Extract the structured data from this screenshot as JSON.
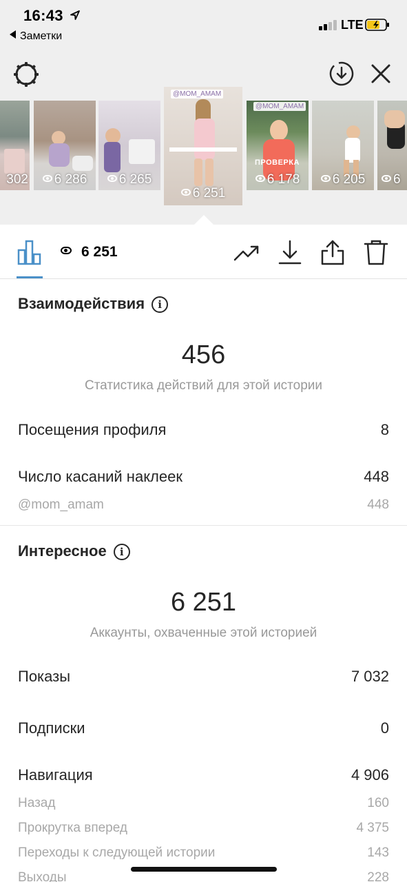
{
  "status_bar": {
    "time": "16:43",
    "back_app": "Заметки",
    "network": "LTE"
  },
  "colors": {
    "accent": "#4a90c8",
    "battery": "#f5c518",
    "header_bg": "#efefef"
  },
  "story_thumbnails": [
    {
      "views": "302",
      "selected": false
    },
    {
      "views": "6 286",
      "selected": false
    },
    {
      "views": "6 265",
      "selected": false
    },
    {
      "views": "6 251",
      "selected": true,
      "tag": "@MOM_AMAM"
    },
    {
      "views": "6 178",
      "selected": false,
      "tag": "@MOM_AMAM",
      "overlay": "ПРОВЕРКА"
    },
    {
      "views": "6 205",
      "selected": false
    },
    {
      "views": "6",
      "selected": false
    }
  ],
  "toolbar": {
    "views": "6 251",
    "icons": [
      "bar-chart-icon",
      "eye-icon",
      "trending-icon",
      "download-icon",
      "share-icon",
      "trash-icon"
    ]
  },
  "interactions": {
    "title": "Взаимодействия",
    "total": "456",
    "caption": "Статистика действий для этой истории",
    "rows": [
      {
        "label": "Посещения профиля",
        "value": "8"
      },
      {
        "label": "Число касаний наклеек",
        "value": "448"
      },
      {
        "label": "@mom_amam",
        "value": "448"
      }
    ]
  },
  "discovery": {
    "title": "Интересное",
    "total": "6 251",
    "caption": "Аккаунты, охваченные этой историей",
    "rows": [
      {
        "label": "Показы",
        "value": "7 032"
      },
      {
        "label": "Подписки",
        "value": "0"
      },
      {
        "label": "Навигация",
        "value": "4 906"
      },
      {
        "label": "Назад",
        "value": "160"
      },
      {
        "label": "Прокрутка вперед",
        "value": "4 375"
      },
      {
        "label": "Переходы к следующей истории",
        "value": "143"
      },
      {
        "label": "Выходы",
        "value": "228"
      }
    ]
  }
}
